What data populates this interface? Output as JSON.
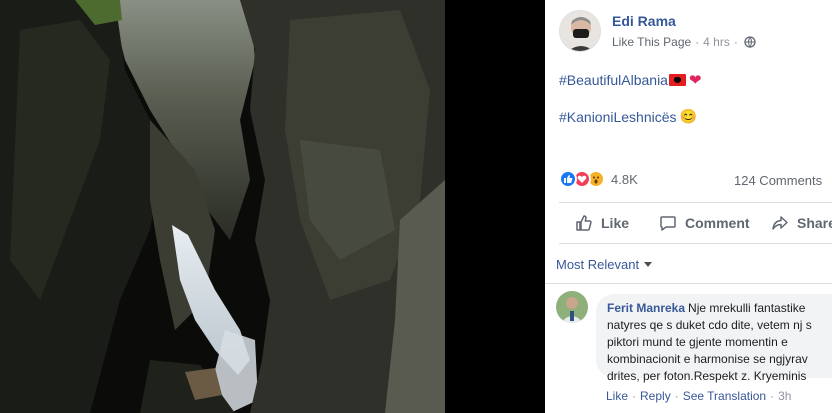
{
  "post": {
    "author": "Edi Rama",
    "page_link": "Like This Page",
    "separator": "·",
    "time": "4 hrs",
    "hashtag1": "#BeautifulAlbania",
    "hashtag2": "#KanioniLeshnicës",
    "emoji_smile": "😊",
    "emoji_heart": "❤"
  },
  "reactions": {
    "count": "4.8K",
    "comments": "124 Comments",
    "types": [
      "like",
      "love",
      "wow"
    ]
  },
  "actions": {
    "like": "Like",
    "comment": "Comment",
    "share": "Share"
  },
  "comments_section": {
    "sort_label": "Most Relevant",
    "items": [
      {
        "author": "Ferit Manreka",
        "lines": [
          "Nje mrekulli fantastike",
          "natyres qe s duket cdo dite, vetem nj s",
          "piktori mund te gjente momentin e",
          "kombinacionit e harmonise se ngjyrav",
          "drites, per foton.Respekt z. Kryeminis"
        ],
        "like": "Like",
        "reply": "Reply",
        "translate": "See Translation",
        "time": "3h",
        "dot": "·"
      }
    ]
  },
  "colors": {
    "link": "#365899",
    "like_blue": "#1877f2",
    "love_red": "#f33e58",
    "wow_yellow": "#f7b125"
  }
}
